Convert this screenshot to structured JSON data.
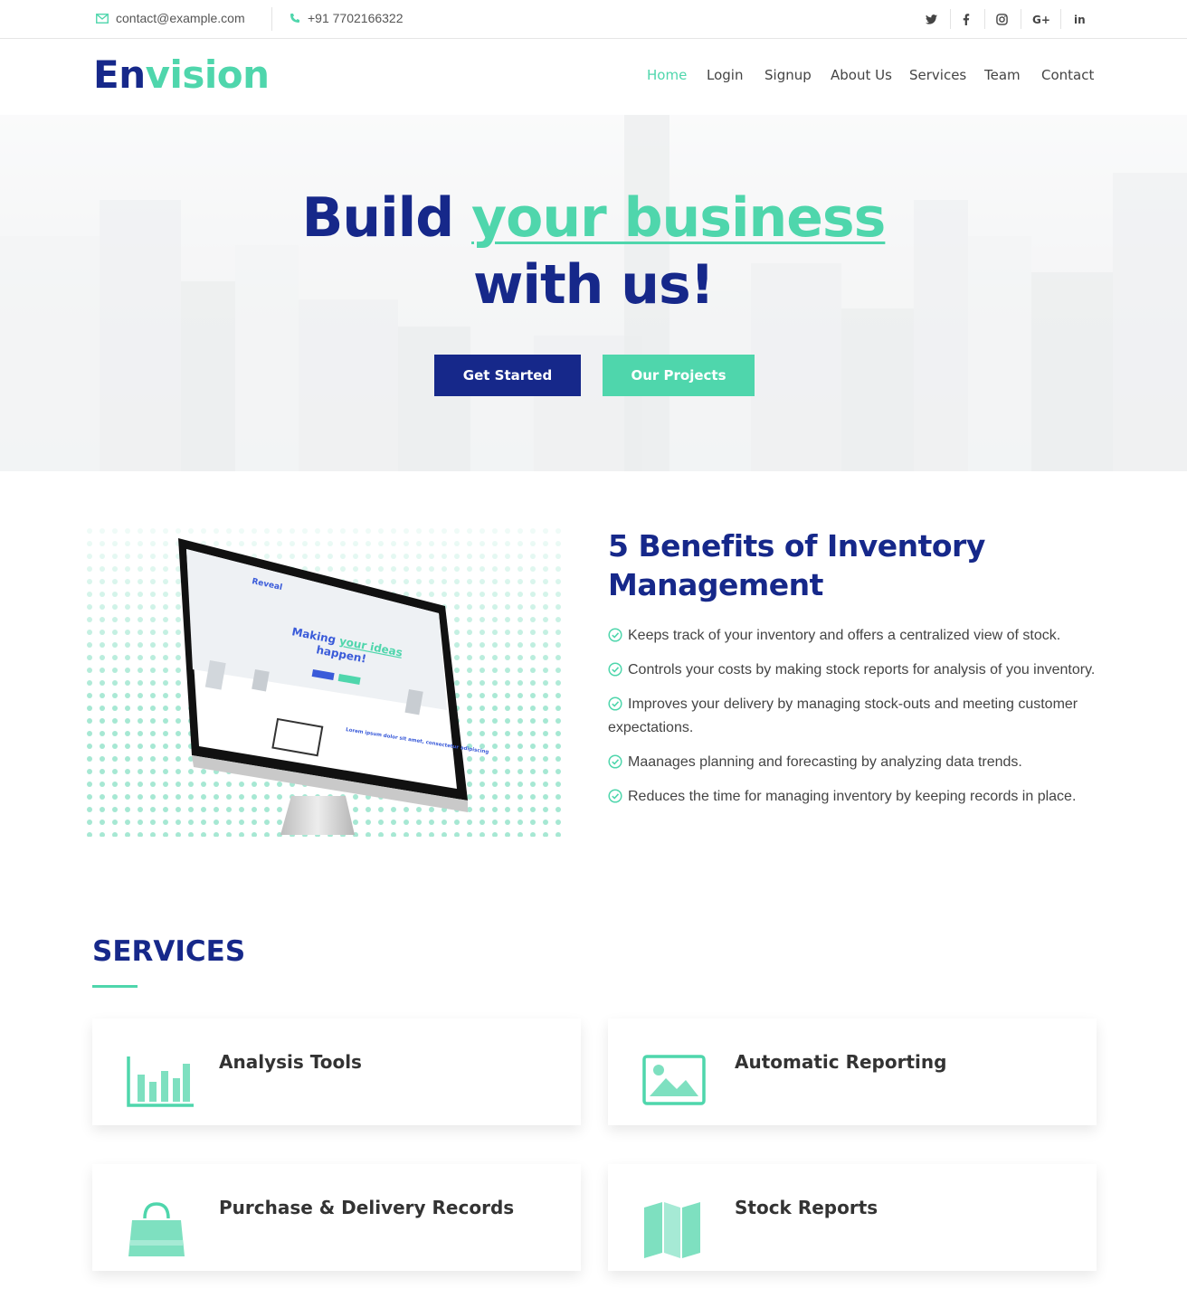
{
  "topbar": {
    "email": "contact@example.com",
    "phone": "+91 7702166322",
    "social": [
      {
        "icon": "twitter-icon",
        "glyph": "🐦"
      },
      {
        "icon": "facebook-icon",
        "glyph": "f"
      },
      {
        "icon": "instagram-icon",
        "glyph": "◎"
      },
      {
        "icon": "google-plus-icon",
        "glyph": "G+"
      },
      {
        "icon": "linkedin-icon",
        "glyph": "in"
      }
    ]
  },
  "brand": {
    "part1": "En",
    "part2": "vision"
  },
  "nav": [
    "Home",
    "Login",
    "Signup",
    "About Us",
    "Services",
    "Team",
    "Contact"
  ],
  "hero": {
    "title_part1": "Build ",
    "title_highlight": "your business",
    "title_line2": "with us!",
    "primary_button": "Get Started",
    "secondary_button": "Our Projects"
  },
  "benefits": {
    "title": "5 Benefits of Inventory Management",
    "items": [
      "Keeps track of your inventory and offers a centralized view of stock.",
      "Controls your costs by making stock reports for analysis of you inventory.",
      "Improves your delivery by managing stock-outs and meeting customer expectations.",
      "Maanages planning and forecasting by analyzing data trends.",
      "Reduces the time for managing inventory by keeping records in place."
    ],
    "screen": {
      "brand": "Reveal",
      "headline1": "Making ",
      "headline_highlight": "your ideas",
      "headline2": "happen!",
      "body_heading": "Lorem ipsum dolor sit amet, consectetur adipiscing"
    }
  },
  "services": {
    "title": "SERVICES",
    "items": [
      {
        "label": "Analysis Tools",
        "icon": "bar-chart-icon"
      },
      {
        "label": "Automatic Reporting",
        "icon": "image-icon"
      },
      {
        "label": "Purchase & Delivery Records",
        "icon": "shopping-bag-icon"
      },
      {
        "label": "Stock Reports",
        "icon": "map-icon"
      }
    ]
  },
  "colors": {
    "primary": "#16288a",
    "accent": "#4fd6ac"
  }
}
